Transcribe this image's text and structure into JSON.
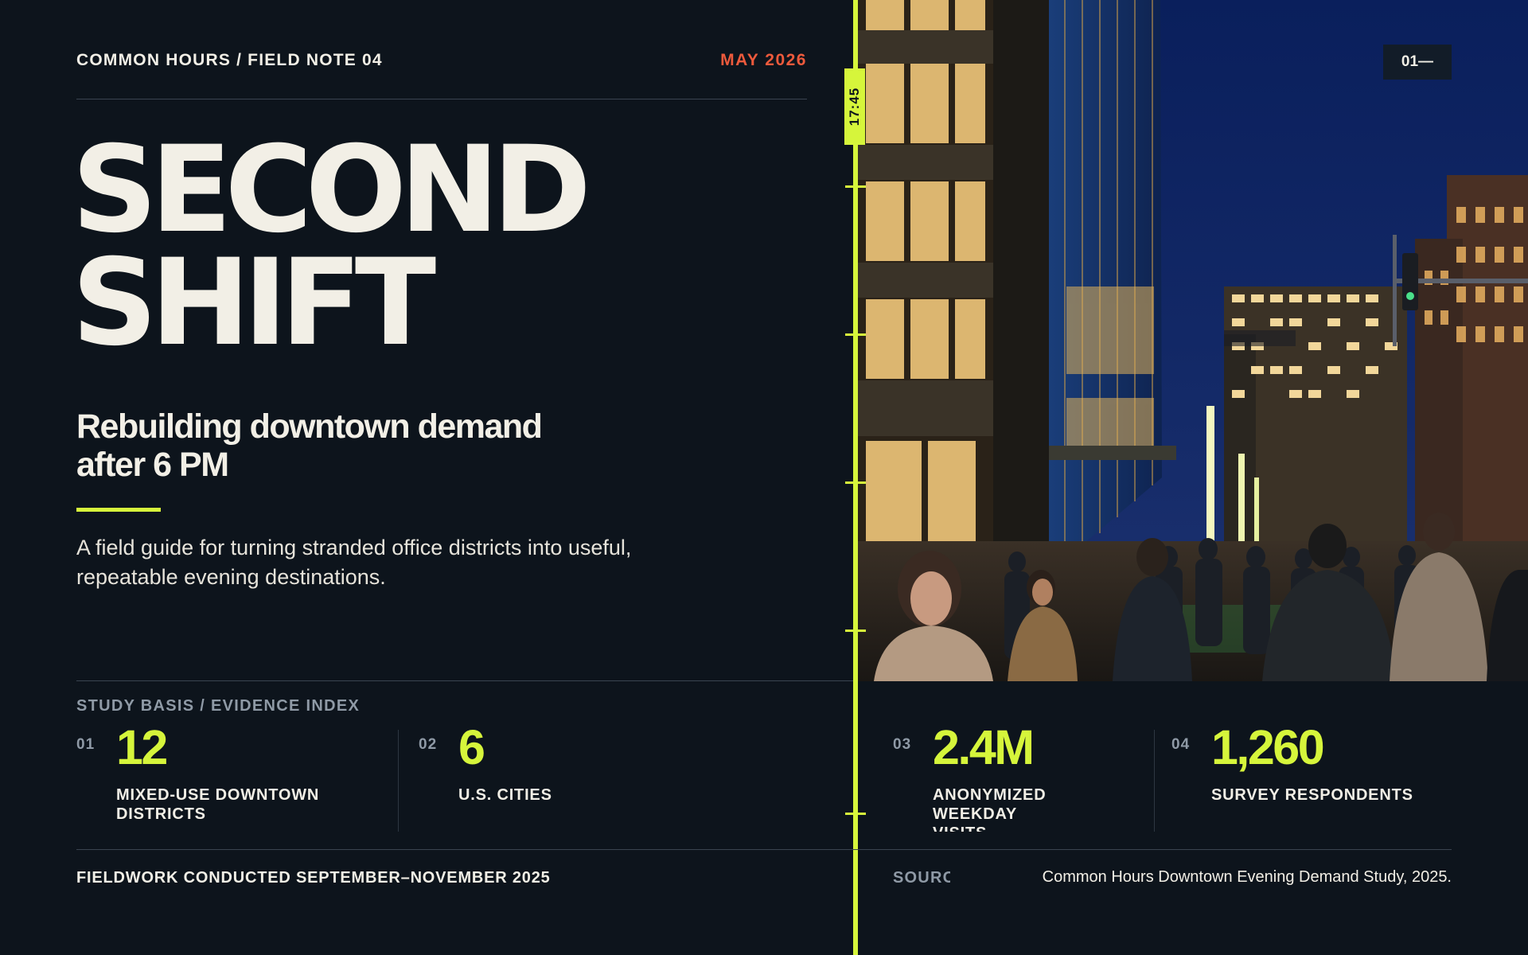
{
  "header": {
    "brand": "COMMON HOURS / FIELD NOTE 04",
    "date": "MAY 2026",
    "page_number": "01—"
  },
  "hero": {
    "title_line1": "SECOND",
    "title_line2": "SHIFT",
    "subtitle": "Rebuilding downtown demand after 6 PM",
    "lede": "A field guide for turning stranded office districts into useful, repeatable evening destinations."
  },
  "timeline": {
    "time_label": "17:45"
  },
  "stats": {
    "section_label": "STUDY BASIS / EVIDENCE INDEX",
    "items": [
      {
        "index": "01",
        "value": "12",
        "label": "MIXED-USE DOWNTOWN DISTRICTS"
      },
      {
        "index": "02",
        "value": "6",
        "label": "U.S. CITIES"
      },
      {
        "index": "03",
        "value": "2.4M",
        "label": "ANONYMIZED WEEKDAY VISITS"
      },
      {
        "index": "04",
        "value": "1,260",
        "label": "SURVEY RESPONDENTS"
      }
    ]
  },
  "footer": {
    "fieldwork": "FIELDWORK CONDUCTED SEPTEMBER–NOVEMBER 2025",
    "source_label": "SOURCE",
    "source_text": "Common Hours Downtown Evening Demand Study, 2025."
  },
  "colors": {
    "background": "#0d141c",
    "accent": "#d6f53b",
    "date_red": "#ee5a3c",
    "text": "#f2efe6",
    "muted": "#8f9aa6"
  }
}
